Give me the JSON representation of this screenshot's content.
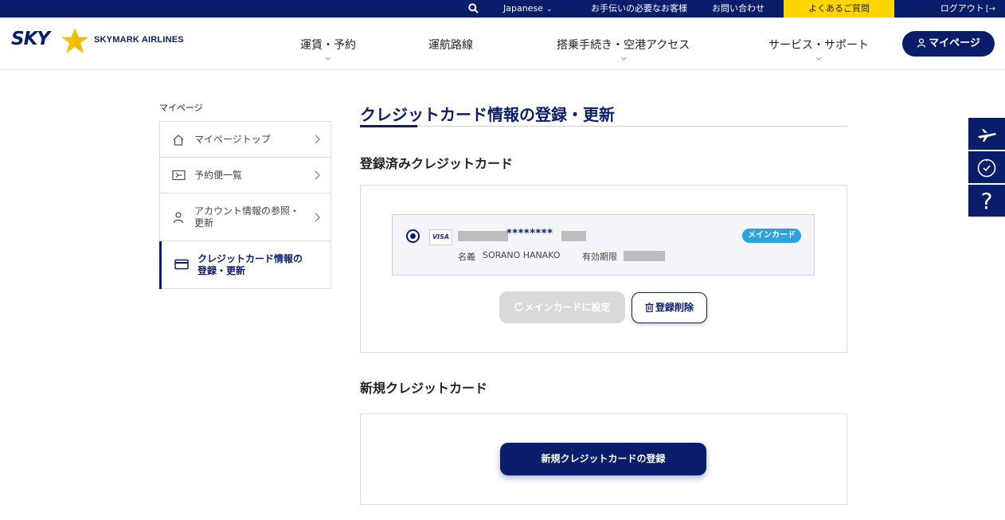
{
  "topbar": {
    "language": "Japanese",
    "help": "お手伝いの必要なお客様",
    "contact": "お問い合わせ",
    "faq": "よくあるご質問",
    "logout": "ログアウト"
  },
  "header": {
    "logo_text": "SKY",
    "brand": "SKYMARK AIRLINES",
    "nav": [
      "運賃・予約",
      "運航路線",
      "搭乗手続き・空港アクセス",
      "サービス・サポート"
    ],
    "mypage_button": "マイページ"
  },
  "sidebar": {
    "title": "マイページ",
    "items": [
      {
        "label": "マイページトップ",
        "icon": "home-icon"
      },
      {
        "label": "予約便一覧",
        "icon": "ticket-icon"
      },
      {
        "label_line1": "アカウント情報の参照・",
        "label_line2": "更新",
        "icon": "user-icon"
      },
      {
        "label_line1": "クレジットカード情報の",
        "label_line2": "登録・更新",
        "icon": "credit-card-icon",
        "active": true
      }
    ]
  },
  "main": {
    "title": "クレジットカード情報の登録・更新",
    "registered_section": "登録済みクレジットカード",
    "card": {
      "brand": "VISA",
      "number_masked": "********",
      "badge": "メインカード",
      "name_label": "名義",
      "name_value": "SORANO HANAKO",
      "expiry_label": "有効期限"
    },
    "set_main_button": "メインカードに設定",
    "delete_button": "登録削除",
    "new_section": "新規クレジットカード",
    "new_button": "新規クレジットカードの登録"
  },
  "colors": {
    "navy": "#0a1d6b",
    "yellow": "#fdd600",
    "badge_blue": "#2aa3df"
  }
}
